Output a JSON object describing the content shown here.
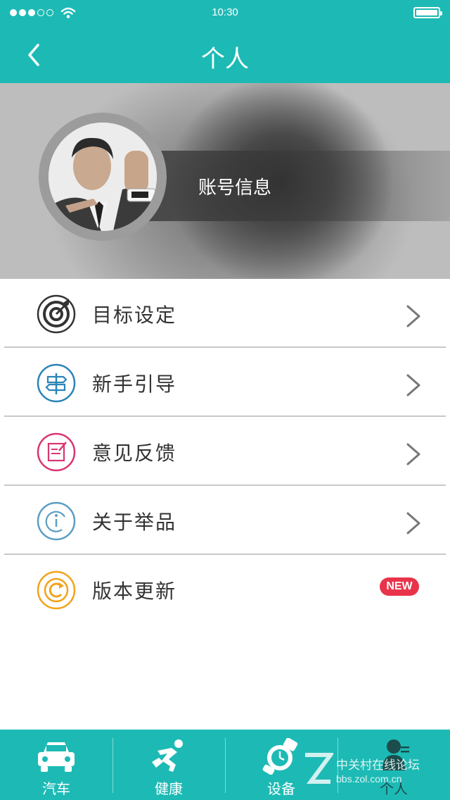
{
  "status_bar": {
    "time": "10:30",
    "signal_icon": "signal-dots-icon",
    "wifi_icon": "wifi-icon",
    "battery_icon": "battery-icon"
  },
  "nav": {
    "title": "个人",
    "back_icon": "chevron-left-icon"
  },
  "profile": {
    "account_label": "账号信息",
    "avatar_icon": "avatar-photo"
  },
  "menu": [
    {
      "label": "目标设定",
      "icon": "target-icon",
      "icon_color": "#333333"
    },
    {
      "label": "新手引导",
      "icon": "signpost-icon",
      "icon_color": "#2a84b6"
    },
    {
      "label": "意见反馈",
      "icon": "feedback-edit-icon",
      "icon_color": "#d93572"
    },
    {
      "label": "关于举品",
      "icon": "info-icon",
      "icon_color": "#5b9ec4"
    },
    {
      "label": "版本更新",
      "icon": "update-icon",
      "icon_color": "#f2a31b",
      "badge": "NEW"
    }
  ],
  "tabs": [
    {
      "label": "汽车",
      "icon": "car-icon"
    },
    {
      "label": "健康",
      "icon": "running-icon"
    },
    {
      "label": "设备",
      "icon": "watch-icon"
    },
    {
      "label": "个人",
      "icon": "person-icon"
    }
  ],
  "watermark": {
    "line1": "中关村在线论坛",
    "line2": "bbs.zol.com.cn"
  },
  "colors": {
    "primary": "#1dbab5",
    "badge": "#e8344a",
    "text": "#333333"
  }
}
